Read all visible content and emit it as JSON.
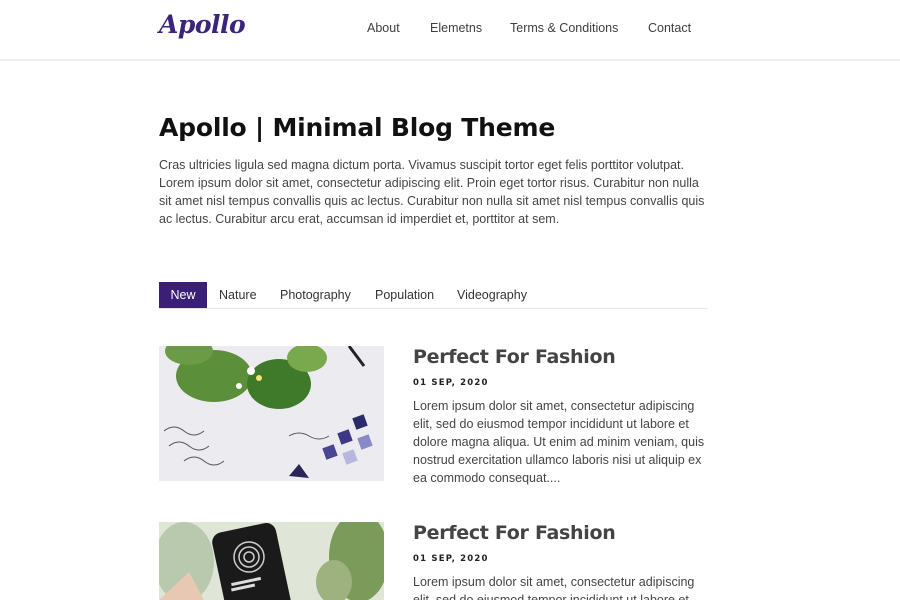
{
  "header": {
    "logo": "Apollo",
    "nav": [
      "About",
      "Elemetns",
      "Terms & Conditions",
      "Contact"
    ]
  },
  "intro": {
    "title": "Apollo | Minimal Blog Theme",
    "text": "Cras ultricies ligula sed magna dictum porta. Vivamus suscipit tortor eget felis porttitor volutpat. Lorem ipsum dolor sit amet, consectetur adipiscing elit. Proin eget tortor risus. Curabitur non nulla sit amet nisl tempus convallis quis ac lectus. Curabitur non nulla sit amet nisl tempus convallis quis ac lectus. Curabitur arcu erat, accumsan id imperdiet et, porttitor at sem."
  },
  "tabs": [
    "New",
    "Nature",
    "Photography",
    "Population",
    "Videography"
  ],
  "active_tab": "New",
  "posts": [
    {
      "title": "Perfect For Fashion",
      "date": "01 SEP, 2020",
      "excerpt": "Lorem ipsum dolor sit amet, consectetur adipiscing elit, sed do eiusmod tempor incididunt ut labore et dolore magna aliqua. Ut enim ad minim veniam, quis nostrud exercitation ullamco laboris nisi ut aliquip ex ea commodo consequat...."
    },
    {
      "title": "Perfect For Fashion",
      "date": "01 SEP, 2020",
      "excerpt": "Lorem ipsum dolor sit amet, consectetur adipiscing elit, sed do eiusmod tempor incididunt ut labore et dolore magna aliqua."
    }
  ],
  "colors": {
    "brand": "#3b1f76",
    "text": "#444444",
    "heading": "#111111"
  }
}
